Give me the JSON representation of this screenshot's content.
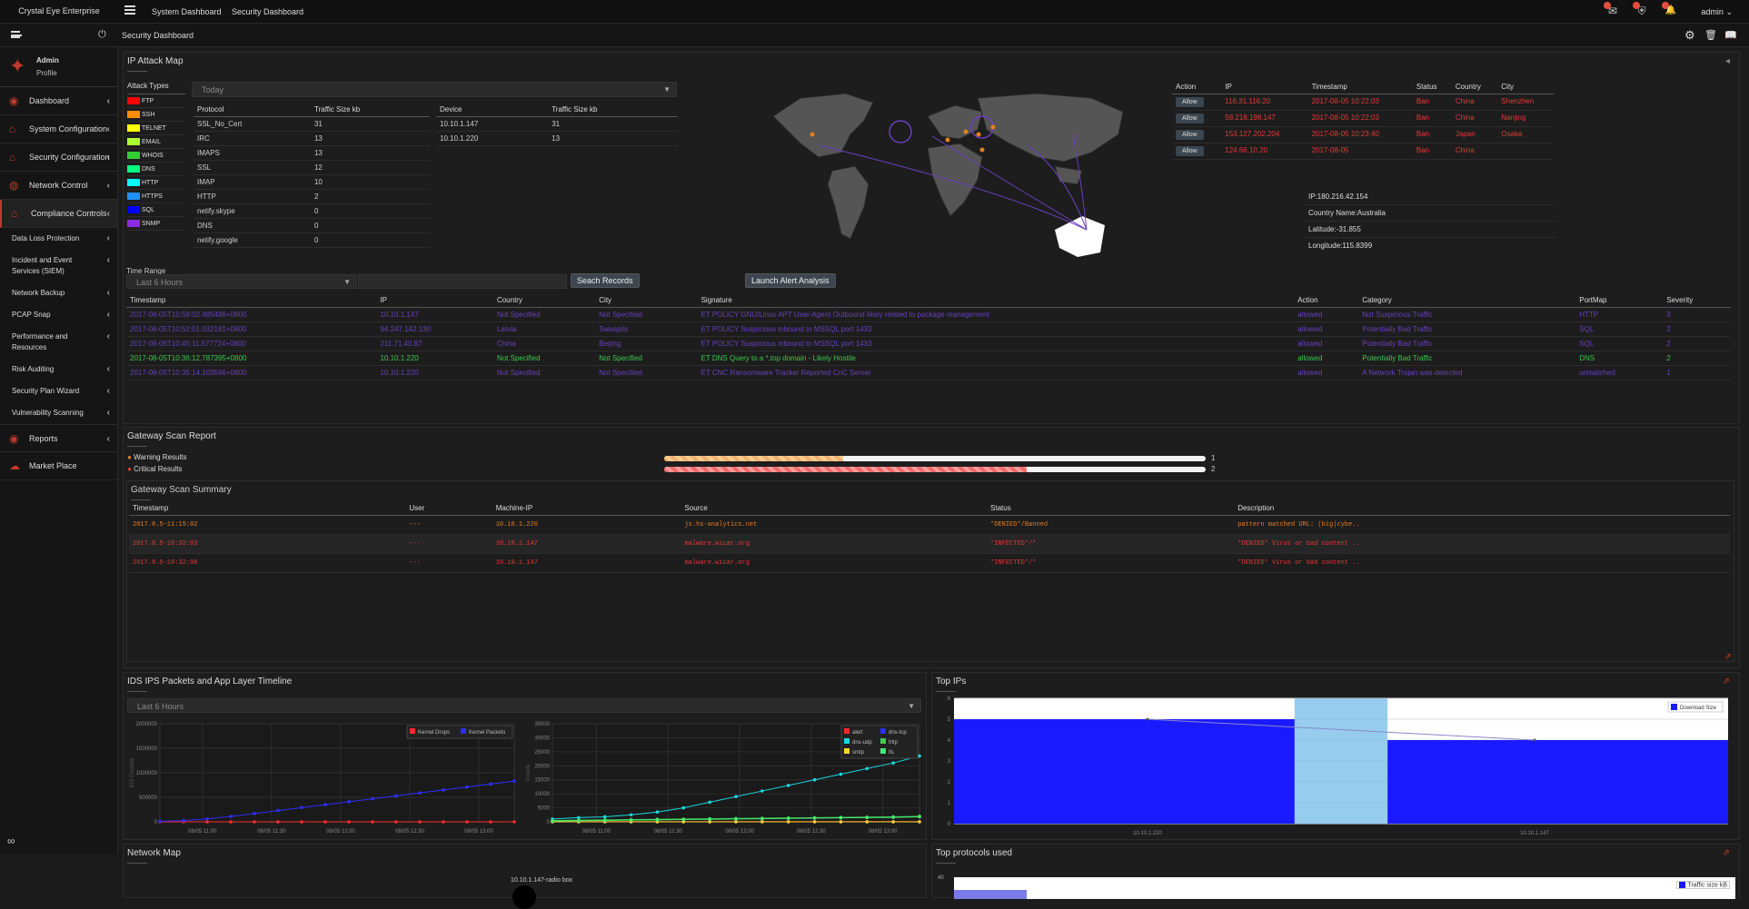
{
  "app": {
    "brand": "Crystal Eye Enterprise",
    "user": "admin",
    "user_chevron": "⌄",
    "page_title": "Security Dashboard"
  },
  "topnav": {
    "links": [
      "System Dashboard",
      "Security Dashboard"
    ]
  },
  "sidebar": {
    "admin_name": "Admin",
    "profile_label": "Profile",
    "items": [
      {
        "label": "Dashboard"
      },
      {
        "label": "System Configuration"
      },
      {
        "label": "Security Configuration"
      },
      {
        "label": "Network Control"
      },
      {
        "label": "Compliance Controls"
      }
    ],
    "sub_items": [
      {
        "label": "Data Loss Protection"
      },
      {
        "label": "Incident and Event Services (SIEM)"
      },
      {
        "label": "Network Backup"
      },
      {
        "label": "PCAP Snap"
      },
      {
        "label": "Performance and Resources"
      },
      {
        "label": "Risk Auditing"
      },
      {
        "label": "Security Plan Wizard"
      },
      {
        "label": "Vulnerability Scanning"
      }
    ],
    "bottom_items": [
      {
        "label": "Reports"
      },
      {
        "label": "Market Place"
      }
    ]
  },
  "ip_attack_map": {
    "title": "IP Attack Map",
    "attack_types_header": "Attack Types",
    "attack_types": [
      {
        "name": "FTP",
        "color": "#ff0000"
      },
      {
        "name": "SSH",
        "color": "#ff8c00"
      },
      {
        "name": "TELNET",
        "color": "#ffff00"
      },
      {
        "name": "EMAIL",
        "color": "#adff2f"
      },
      {
        "name": "WHOIS",
        "color": "#32cd32"
      },
      {
        "name": "DNS",
        "color": "#00ff7f"
      },
      {
        "name": "HTTP",
        "color": "#00ffff"
      },
      {
        "name": "HTTPS",
        "color": "#1e90ff"
      },
      {
        "name": "SQL",
        "color": "#0000ff"
      },
      {
        "name": "SNMP",
        "color": "#8a2be2"
      }
    ],
    "period_select": "Today",
    "protocol_headers": [
      "Protocol",
      "Traffic Size kb"
    ],
    "protocols": [
      [
        "SSL_No_Cert",
        "31"
      ],
      [
        "IRC",
        "13"
      ],
      [
        "IMAPS",
        "13"
      ],
      [
        "SSL",
        "12"
      ],
      [
        "IMAP",
        "10"
      ],
      [
        "HTTP",
        "2"
      ],
      [
        "netify.skype",
        "0"
      ],
      [
        "DNS",
        "0"
      ],
      [
        "netify.google",
        "0"
      ]
    ],
    "device_headers": [
      "Device",
      "Traffic Size kb"
    ],
    "devices": [
      [
        "10.10.1.147",
        "31"
      ],
      [
        "10.10.1.220",
        "13"
      ]
    ],
    "ban_headers": [
      "Action",
      "IP",
      "Timestamp",
      "Status",
      "Country",
      "City"
    ],
    "ban_rows": [
      {
        "action": "Allow",
        "ip": "116.31.116.20",
        "ts": "2017-08-05 10:22:03",
        "status": "Ban",
        "country": "China",
        "city": "Shenzhen"
      },
      {
        "action": "Allow",
        "ip": "58.218.198.147",
        "ts": "2017-08-05 10:22:03",
        "status": "Ban",
        "country": "China",
        "city": "Nanjing"
      },
      {
        "action": "Allow",
        "ip": "153.127.202.204",
        "ts": "2017-08-05 10:23:40",
        "status": "Ban",
        "country": "Japan",
        "city": "Osaka"
      },
      {
        "action": "Allow",
        "ip": "124.66.10.20",
        "ts": "2017-08-05",
        "status": "Ban",
        "country": "China",
        "city": ""
      }
    ],
    "ip_info": {
      "ip": "IP:180.216.42.154",
      "country": "Country Name:Australia",
      "lat": "Latitude:-31.855",
      "lon": "Longitude:115.8399"
    }
  },
  "records": {
    "time_range_label": "Time Range",
    "time_range": "Last 6 Hours",
    "search_btn": "Seach Records",
    "alert_btn": "Launch Alert Analysis",
    "headers": [
      "Timestamp",
      "IP",
      "Country",
      "City",
      "Signature",
      "Action",
      "Category",
      "PortMap",
      "Severity"
    ],
    "rows": [
      {
        "c": "purple",
        "cells": [
          "2017-08-05T10:59:02.485486+0800",
          "10.10.1.147",
          "Not Specified",
          "Not Specified",
          "ET POLICY GNU/Linux APT User-Agent Outbound likely related to package management",
          "allowed",
          "Not Suspicious Traffic",
          "HTTP",
          "3"
        ]
      },
      {
        "c": "purple",
        "cells": [
          "2017-08-05T10:52:01.032191+0800",
          "94.247.142.130",
          "Latvia",
          "Salaspils",
          "ET POLICY Suspicious inbound to MSSQL port 1433",
          "allowed",
          "Potentially Bad Traffic",
          "SQL",
          "2"
        ]
      },
      {
        "c": "purple",
        "cells": [
          "2017-08-05T10:45:11.577724+0800",
          "211.71.40.87",
          "China",
          "Beijing",
          "ET POLICY Suspicious inbound to MSSQL port 1433",
          "allowed",
          "Potentially Bad Traffic",
          "SQL",
          "2"
        ]
      },
      {
        "c": "green",
        "cells": [
          "2017-08-05T10:36:12.787395+0800",
          "10.10.1.220",
          "Not Specified",
          "Not Specified",
          "ET DNS Query to a *.top domain - Likely Hostile",
          "allowed",
          "Potentially Bad Traffic",
          "DNS",
          "2"
        ]
      },
      {
        "c": "purple",
        "cells": [
          "2017-08-05T10:35:14.103566+0800",
          "10.10.1.220",
          "Not Specified",
          "Not Specified",
          "ET CNC Ransomware Tracker Reported CnC Server",
          "allowed",
          "A Network Trojan was detected",
          "unmatched",
          "1"
        ]
      }
    ]
  },
  "gateway_scan": {
    "title": "Gateway Scan Report",
    "warning_label": "Warning Results",
    "critical_label": "Critical Results",
    "warning_fraction": 0.33,
    "critical_fraction": 0.67,
    "warning_count": "1",
    "critical_count": "2",
    "summary_title": "Gateway Scan Summary",
    "headers": [
      "Timestamp",
      "User",
      "Machine-IP",
      "Source",
      "Status",
      "Description"
    ],
    "rows": [
      {
        "c": "orange",
        "cells": [
          "2017.8.5-11:15:02",
          "---",
          "10.10.1.220",
          "js.hs-analytics.net",
          "*DENIED*/Banned",
          "pattern matched URL: (big|cybe.."
        ]
      },
      {
        "c": "red",
        "cells": [
          "2017.8.5-10:32:03",
          "---",
          "10.10.1.147",
          "malware.wicar.org",
          "*INFECTED*/*",
          "*DENIED* Virus or bad content .."
        ]
      },
      {
        "c": "red",
        "cells": [
          "2017.8.5-10:32:00",
          "---",
          "10.10.1.147",
          "malware.wicar.org",
          "*INFECTED*/*",
          "*DENIED* Virus or bad content .."
        ]
      }
    ]
  },
  "ids_timeline": {
    "title": "IDS IPS Packets and App Layer Timeline",
    "range": "Last 6 Hours",
    "left_ylabel": "IDS Packets",
    "right_ylabel": "Events",
    "left_legend": [
      {
        "name": "Kernel Drops",
        "color": "#ff2b2b"
      },
      {
        "name": "Kernel Packets",
        "color": "#2d2dff"
      }
    ],
    "right_legend": [
      {
        "name": "alert",
        "color": "#ff2b2b"
      },
      {
        "name": "dns-tcp",
        "color": "#2d2dff"
      },
      {
        "name": "dns-udp",
        "color": "#19d6e0"
      },
      {
        "name": "http",
        "color": "#3ccf4e"
      },
      {
        "name": "smtp",
        "color": "#f5d533"
      },
      {
        "name": "tls",
        "color": "#46e874"
      }
    ]
  },
  "chart_data": [
    {
      "type": "line",
      "x": [
        "08/05 11:00",
        "08/05 11:30",
        "08/05 12:00",
        "08/05 12:30",
        "08/05 13:00"
      ],
      "yticks": [
        "0",
        "500000",
        "1000000",
        "1500000",
        "2000000"
      ],
      "ylim": [
        0,
        2000000
      ],
      "ylabel": "IDS Packets",
      "series": [
        {
          "name": "Kernel Drops",
          "color": "#ff2b2b",
          "values": [
            0,
            0,
            0,
            0,
            0,
            0,
            0,
            0,
            0,
            0,
            0,
            0,
            0,
            0,
            0,
            0
          ]
        },
        {
          "name": "Kernel Packets",
          "color": "#2d2dff",
          "values": [
            10000,
            25000,
            60000,
            110000,
            170000,
            230000,
            290000,
            350000,
            410000,
            470000,
            530000,
            590000,
            650000,
            710000,
            770000,
            830000
          ]
        }
      ]
    },
    {
      "type": "line",
      "x": [
        "08/05 11:00",
        "08/05 11:30",
        "08/05 12:00",
        "08/05 12:30",
        "08/05 13:00"
      ],
      "yticks": [
        "0",
        "5000",
        "10000",
        "15000",
        "20000",
        "25000",
        "30000",
        "35000"
      ],
      "ylim": [
        0,
        35000
      ],
      "ylabel": "Events",
      "series": [
        {
          "name": "alert",
          "color": "#ff2b2b",
          "values": [
            100,
            100,
            100,
            100,
            100,
            100,
            100,
            100,
            100,
            100,
            100,
            100,
            100,
            100,
            100
          ]
        },
        {
          "name": "dns-tcp",
          "color": "#2d2dff",
          "values": [
            0,
            0,
            0,
            0,
            0,
            0,
            0,
            0,
            0,
            0,
            0,
            0,
            0,
            0,
            0
          ]
        },
        {
          "name": "dns-udp",
          "color": "#19d6e0",
          "values": [
            1000,
            1500,
            1800,
            2500,
            3500,
            5000,
            7000,
            9000,
            11000,
            13000,
            15000,
            17000,
            19000,
            21000,
            23500
          ]
        },
        {
          "name": "http",
          "color": "#3ccf4e",
          "values": [
            500,
            600,
            700,
            800,
            900,
            1000,
            1100,
            1200,
            1300,
            1400,
            1500,
            1600,
            1700,
            1800,
            2000
          ]
        },
        {
          "name": "smtp",
          "color": "#f5d533",
          "values": [
            0,
            0,
            0,
            0,
            0,
            0,
            0,
            0,
            0,
            0,
            0,
            0,
            0,
            0,
            0
          ]
        },
        {
          "name": "tls",
          "color": "#46e874",
          "values": [
            300,
            400,
            500,
            600,
            700,
            800,
            900,
            1000,
            1100,
            1200,
            1300,
            1400,
            1500,
            1600,
            1800
          ]
        }
      ]
    },
    {
      "type": "bar",
      "title": "Top IPs",
      "categories": [
        "10.10.1.220",
        "10.10.1.147"
      ],
      "series": [
        {
          "name": "Download Size",
          "color": "#1a1aff",
          "values": [
            5,
            4
          ]
        }
      ],
      "yticks": [
        "0",
        "1",
        "2",
        "3",
        "4",
        "5",
        "6"
      ],
      "ylim": [
        0,
        6
      ]
    }
  ],
  "top_ips": {
    "title": "Top IPs",
    "legend": "Download Size"
  },
  "network_map": {
    "title": "Network Map",
    "node_label": "10.10.1.147-radio box"
  },
  "top_protocols": {
    "title": "Top protocols used",
    "legend": "Traffic size kB",
    "ytick": "40"
  },
  "icons": {
    "mail": "✉",
    "shield": "⛨",
    "bell": "🔔",
    "settings": "⚙",
    "trash": "🗑",
    "book": "📖",
    "power": "⏻"
  },
  "colors": {
    "accent": "#c0392b",
    "bg": "#1b1b1b",
    "panel": "#1d1d1d"
  }
}
